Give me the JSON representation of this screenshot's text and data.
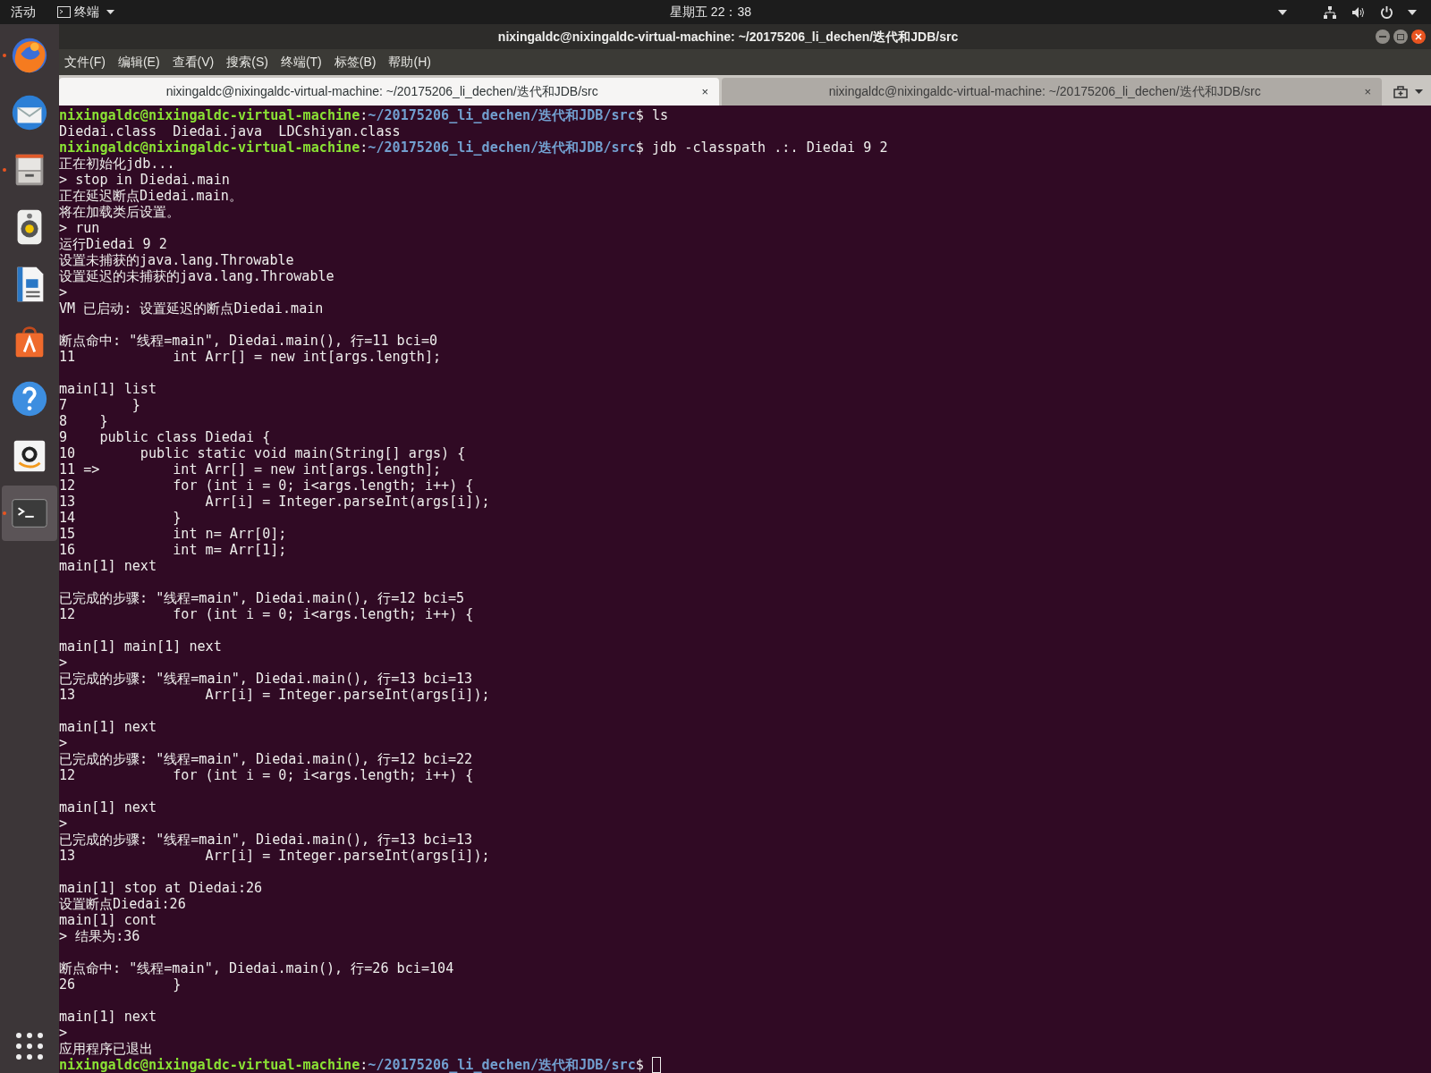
{
  "top_bar": {
    "activities": "活动",
    "app_menu": "终端",
    "clock": "星期五 22：38"
  },
  "dock": {
    "items": [
      {
        "kind": "browser",
        "running": true,
        "selected": false
      },
      {
        "kind": "mail",
        "running": false,
        "selected": false
      },
      {
        "kind": "files",
        "running": true,
        "selected": false
      },
      {
        "kind": "music",
        "running": false,
        "selected": false
      },
      {
        "kind": "document",
        "running": false,
        "selected": false
      },
      {
        "kind": "store",
        "running": false,
        "selected": false
      },
      {
        "kind": "help",
        "running": false,
        "selected": false
      },
      {
        "kind": "shop",
        "running": false,
        "selected": false
      },
      {
        "kind": "terminal",
        "running": true,
        "selected": true
      }
    ]
  },
  "window": {
    "title": "nixingaldc@nixingaldc-virtual-machine: ~/20175206_li_dechen/迭代和JDB/src",
    "menu": [
      "文件(F)",
      "编辑(E)",
      "查看(V)",
      "搜索(S)",
      "终端(T)",
      "标签(B)",
      "帮助(H)"
    ],
    "tabs": [
      {
        "title": "nixingaldc@nixingaldc-virtual-machine: ~/20175206_li_dechen/迭代和JDB/src",
        "close": "×",
        "selected": true
      },
      {
        "title": "nixingaldc@nixingaldc-virtual-machine: ~/20175206_li_dechen/迭代和JDB/src",
        "close": "×",
        "selected": false
      }
    ]
  },
  "terminal": {
    "lines": [
      {
        "kind": "prompt",
        "user": "nixingaldc@nixingaldc-virtual-machine",
        "sep": ":",
        "path": "~/20175206_li_dechen/迭代和JDB/src",
        "sign": "$",
        "command": "ls",
        "cursor": false
      },
      {
        "kind": "output",
        "text": "Diedai.class  Diedai.java  LDCshiyan.class"
      },
      {
        "kind": "prompt",
        "user": "nixingaldc@nixingaldc-virtual-machine",
        "sep": ":",
        "path": "~/20175206_li_dechen/迭代和JDB/src",
        "sign": "$",
        "command": "jdb -classpath .:. Diedai 9 2",
        "cursor": false
      },
      {
        "kind": "output",
        "text": "正在初始化jdb..."
      },
      {
        "kind": "output",
        "text": "> stop in Diedai.main"
      },
      {
        "kind": "output",
        "text": "正在延迟断点Diedai.main。"
      },
      {
        "kind": "output",
        "text": "将在加载类后设置。"
      },
      {
        "kind": "output",
        "text": "> run"
      },
      {
        "kind": "output",
        "text": "运行Diedai 9 2"
      },
      {
        "kind": "output",
        "text": "设置未捕获的java.lang.Throwable"
      },
      {
        "kind": "output",
        "text": "设置延迟的未捕获的java.lang.Throwable"
      },
      {
        "kind": "output",
        "text": ">"
      },
      {
        "kind": "output",
        "text": "VM 已启动: 设置延迟的断点Diedai.main"
      },
      {
        "kind": "blank"
      },
      {
        "kind": "output",
        "text": "断点命中: \"线程=main\", Diedai.main(), 行=11 bci=0"
      },
      {
        "kind": "output",
        "text": "11            int Arr[] = new int[args.length];"
      },
      {
        "kind": "blank"
      },
      {
        "kind": "output",
        "text": "main[1] list"
      },
      {
        "kind": "output",
        "text": "7        }"
      },
      {
        "kind": "output",
        "text": "8    }"
      },
      {
        "kind": "output",
        "text": "9    public class Diedai {"
      },
      {
        "kind": "output",
        "text": "10        public static void main(String[] args) {"
      },
      {
        "kind": "output",
        "text": "11 =>         int Arr[] = new int[args.length];"
      },
      {
        "kind": "output",
        "text": "12            for (int i = 0; i<args.length; i++) {"
      },
      {
        "kind": "output",
        "text": "13                Arr[i] = Integer.parseInt(args[i]);"
      },
      {
        "kind": "output",
        "text": "14            }"
      },
      {
        "kind": "output",
        "text": "15            int n= Arr[0];"
      },
      {
        "kind": "output",
        "text": "16            int m= Arr[1];"
      },
      {
        "kind": "output",
        "text": "main[1] next"
      },
      {
        "kind": "blank"
      },
      {
        "kind": "output",
        "text": "已完成的步骤: \"线程=main\", Diedai.main(), 行=12 bci=5"
      },
      {
        "kind": "output",
        "text": "12            for (int i = 0; i<args.length; i++) {"
      },
      {
        "kind": "blank"
      },
      {
        "kind": "output",
        "text": "main[1] main[1] next"
      },
      {
        "kind": "output",
        "text": ">"
      },
      {
        "kind": "output",
        "text": "已完成的步骤: \"线程=main\", Diedai.main(), 行=13 bci=13"
      },
      {
        "kind": "output",
        "text": "13                Arr[i] = Integer.parseInt(args[i]);"
      },
      {
        "kind": "blank"
      },
      {
        "kind": "output",
        "text": "main[1] next"
      },
      {
        "kind": "output",
        "text": ">"
      },
      {
        "kind": "output",
        "text": "已完成的步骤: \"线程=main\", Diedai.main(), 行=12 bci=22"
      },
      {
        "kind": "output",
        "text": "12            for (int i = 0; i<args.length; i++) {"
      },
      {
        "kind": "blank"
      },
      {
        "kind": "output",
        "text": "main[1] next"
      },
      {
        "kind": "output",
        "text": ">"
      },
      {
        "kind": "output",
        "text": "已完成的步骤: \"线程=main\", Diedai.main(), 行=13 bci=13"
      },
      {
        "kind": "output",
        "text": "13                Arr[i] = Integer.parseInt(args[i]);"
      },
      {
        "kind": "blank"
      },
      {
        "kind": "output",
        "text": "main[1] stop at Diedai:26"
      },
      {
        "kind": "output",
        "text": "设置断点Diedai:26"
      },
      {
        "kind": "output",
        "text": "main[1] cont"
      },
      {
        "kind": "output",
        "text": "> 结果为:36"
      },
      {
        "kind": "blank"
      },
      {
        "kind": "output",
        "text": "断点命中: \"线程=main\", Diedai.main(), 行=26 bci=104"
      },
      {
        "kind": "output",
        "text": "26            }"
      },
      {
        "kind": "blank"
      },
      {
        "kind": "output",
        "text": "main[1] next"
      },
      {
        "kind": "output",
        "text": ">"
      },
      {
        "kind": "output",
        "text": "应用程序已退出"
      },
      {
        "kind": "prompt",
        "user": "nixingaldc@nixingaldc-virtual-machine",
        "sep": ":",
        "path": "~/20175206_li_dechen/迭代和JDB/src",
        "sign": "$",
        "cursor": true
      }
    ]
  }
}
